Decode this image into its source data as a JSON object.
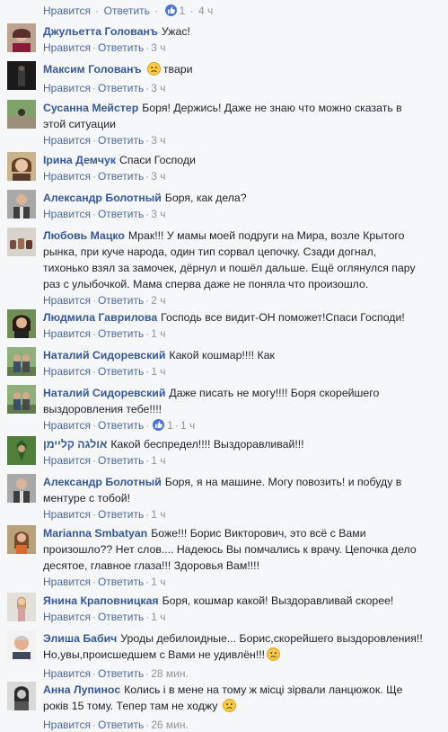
{
  "actions": {
    "like": "Нравится",
    "reply": "Ответить",
    "sep": "·"
  },
  "top": {
    "likes": "1",
    "time": "4 ч"
  },
  "comments": [
    {
      "author": "Джульетта Голованъ",
      "text": "Ужас!",
      "time": "3 ч"
    },
    {
      "author": "Максим Голованъ",
      "text": "твари",
      "time": "3 ч",
      "emoji": "sad"
    },
    {
      "author": "Сусанна Мейстер",
      "text": "Боря! Держись! Даже не знаю что можно сказать в этой ситуации",
      "time": "3 ч"
    },
    {
      "author": "Ірина Демчук",
      "text": "Спаси Господи",
      "time": "3 ч"
    },
    {
      "author": "Александр Болотный",
      "text": "Боря, как дела?",
      "time": "3 ч"
    },
    {
      "author": "Любовь Мацко",
      "text": "Мрак!!! У мамы моей подруги на Мира, возле Крытого рынка, при куче народа, один тип сорвал цепочку. Сзади догнал, тихонько взял за замочек, дёрнул и пошёл дальше. Ещё оглянулся пару раз с улыбочкой. Мама сперва даже не поняла что произошло.",
      "time": "2 ч"
    },
    {
      "author": "Людмила Гаврилова",
      "text": "Господь все видит-ОН поможет!Спаси Господи!",
      "time": "1 ч"
    },
    {
      "author": "Наталий Сидоревский",
      "text": "Какой кошмар!!!! Как",
      "time": "1 ч"
    },
    {
      "author": "Наталий Сидоревский",
      "text": "Даже писать не могу!!!! Боря скорейшего выздоровления тебе!!!!",
      "time": "1 ч",
      "likes": "1"
    },
    {
      "author": "אולגה קליימן",
      "text": "Какой беспредел!!!! Выздоравливай!!!",
      "time": "1 ч"
    },
    {
      "author": "Александр Болотный",
      "text": "Боря, я на машине. Могу повозить! и побуду в ментуре с тобой!",
      "time": "1 ч"
    },
    {
      "author": "Marianna Smbatyan",
      "text": "Боже!!! Борис Викторович, это всё с Вами произошло?? Нет слов.... Надеюсь Вы помчались к врачу. Цепочка дело десятое, главное глаза!!! Здоровья Вам!!!!",
      "time": "1 ч"
    },
    {
      "author": "Янина Краповницкая",
      "text": "Боря, кошмар какой! Выздоравливай скорее!",
      "time": "1 ч"
    },
    {
      "author": "Элиша Бабич",
      "text": "Уроды дебилоидные... Борис,скорейшего выздоровления!! Но,увы,происшедшем с Вами не удивлён!!!",
      "time": "28 мин.",
      "emoji": "sad"
    },
    {
      "author": "Анна Лупинос",
      "text": "Колись і в мене на тому ж місці зірвали ланцюжок. Ще років 15 тому. Тепер там не ходжу",
      "time": "26 мин.",
      "emoji": "sad"
    }
  ],
  "colors": {
    "link": "#365899",
    "meta": "#90949c",
    "like_badge": "#4c73d3",
    "background": "#f6f7f9"
  }
}
